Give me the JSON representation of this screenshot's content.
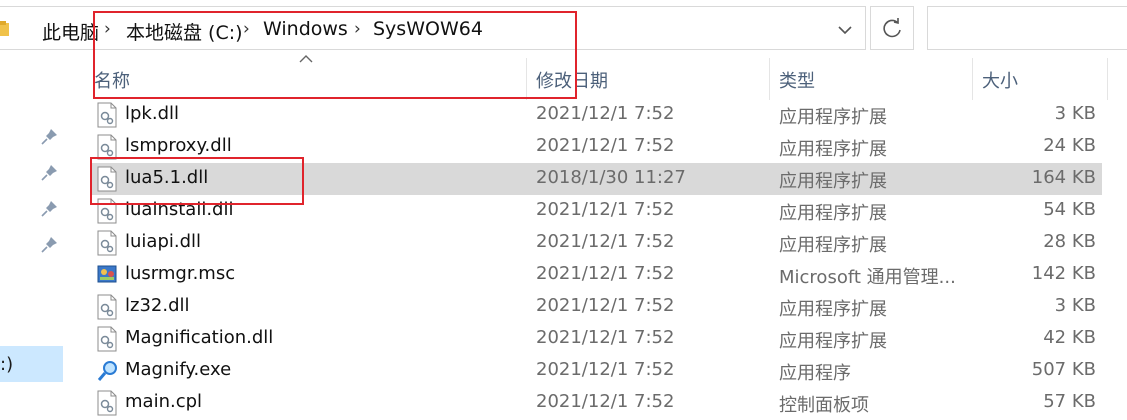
{
  "breadcrumb": {
    "items": [
      "此电脑",
      "本地磁盘 (C:)",
      "Windows",
      "SysWOW64"
    ]
  },
  "columns": {
    "name": "名称",
    "date": "修改日期",
    "type": "类型",
    "size": "大小"
  },
  "nav": {
    "drive_label": ":)"
  },
  "files": [
    {
      "name": "lpk.dll",
      "date": "2021/12/1 7:52",
      "type": "应用程序扩展",
      "size": "3 KB",
      "icon": "dll-file-icon"
    },
    {
      "name": "lsmproxy.dll",
      "date": "2021/12/1 7:52",
      "type": "应用程序扩展",
      "size": "24 KB",
      "icon": "dll-file-icon"
    },
    {
      "name": "lua5.1.dll",
      "date": "2018/1/30 11:27",
      "type": "应用程序扩展",
      "size": "164 KB",
      "icon": "dll-file-icon",
      "selected": true
    },
    {
      "name": "luainstall.dll",
      "date": "2021/12/1 7:52",
      "type": "应用程序扩展",
      "size": "54 KB",
      "icon": "dll-file-icon"
    },
    {
      "name": "luiapi.dll",
      "date": "2021/12/1 7:52",
      "type": "应用程序扩展",
      "size": "28 KB",
      "icon": "dll-file-icon"
    },
    {
      "name": "lusrmgr.msc",
      "date": "2021/12/1 7:52",
      "type": "Microsoft 通用管理...",
      "size": "142 KB",
      "icon": "msc-file-icon"
    },
    {
      "name": "lz32.dll",
      "date": "2021/12/1 7:52",
      "type": "应用程序扩展",
      "size": "3 KB",
      "icon": "dll-file-icon"
    },
    {
      "name": "Magnification.dll",
      "date": "2021/12/1 7:52",
      "type": "应用程序扩展",
      "size": "42 KB",
      "icon": "dll-file-icon"
    },
    {
      "name": "Magnify.exe",
      "date": "2021/12/1 7:52",
      "type": "应用程序",
      "size": "507 KB",
      "icon": "magnifier-exe-icon"
    },
    {
      "name": "main.cpl",
      "date": "2021/12/1 7:52",
      "type": "控制面板项",
      "size": "57 KB",
      "icon": "dll-file-icon"
    }
  ],
  "colors": {
    "selected_row": "#d9d9d9",
    "annotation_red": "#e0242c",
    "header_text": "#4c607a",
    "nav_selected": "#cce8ff"
  }
}
